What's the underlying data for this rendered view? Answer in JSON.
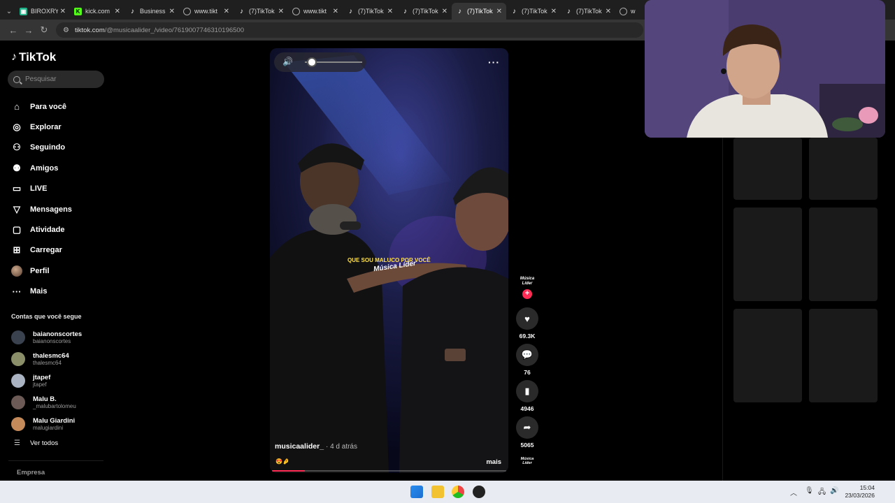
{
  "browser": {
    "tabs": [
      {
        "title": "BIROXRY",
        "icon": "teal-app-icon",
        "active": false
      },
      {
        "title": "kick.com",
        "icon": "kick-icon",
        "active": false
      },
      {
        "title": "Business",
        "icon": "tiktok-icon",
        "active": false
      },
      {
        "title": "www.tikt",
        "icon": "globe-icon",
        "active": false
      },
      {
        "title": "(7)TikTok",
        "icon": "tiktok-icon",
        "active": false
      },
      {
        "title": "www.tikt",
        "icon": "globe-icon",
        "active": false
      },
      {
        "title": "(7)TikTok",
        "icon": "tiktok-icon",
        "active": false
      },
      {
        "title": "(7)TikTok",
        "icon": "tiktok-icon",
        "active": false
      },
      {
        "title": "(7)TikTok",
        "icon": "tiktok-icon",
        "active": true
      },
      {
        "title": "(7)TikTok",
        "icon": "tiktok-icon",
        "active": false
      },
      {
        "title": "(7)TikTok",
        "icon": "tiktok-icon",
        "active": false
      },
      {
        "title": "w",
        "icon": "globe-icon",
        "active": false
      }
    ],
    "url_host": "tiktok.com",
    "url_path": "/@musicaalider_/video/7619007746310196500"
  },
  "sidebar": {
    "logo": "TikTok",
    "search_placeholder": "Pesquisar",
    "nav": [
      {
        "label": "Para você",
        "icon": "home-icon",
        "glyph": "⌂"
      },
      {
        "label": "Explorar",
        "icon": "compass-icon",
        "glyph": "◎"
      },
      {
        "label": "Seguindo",
        "icon": "following-icon",
        "glyph": "⚇"
      },
      {
        "label": "Amigos",
        "icon": "friends-icon",
        "glyph": "⚉"
      },
      {
        "label": "LIVE",
        "icon": "live-icon",
        "glyph": "▭"
      },
      {
        "label": "Mensagens",
        "icon": "messages-icon",
        "glyph": "▽",
        "badge": "7"
      },
      {
        "label": "Atividade",
        "icon": "activity-icon",
        "glyph": "▢"
      },
      {
        "label": "Carregar",
        "icon": "upload-icon",
        "glyph": "⊞"
      },
      {
        "label": "Perfil",
        "icon": "profile-avatar-icon",
        "glyph": ""
      },
      {
        "label": "Mais",
        "icon": "more-icon",
        "glyph": "···"
      }
    ],
    "following_header": "Contas que você segue",
    "following": [
      {
        "name": "baianonscortes",
        "handle": "baianonscortes",
        "color": "#3a4250"
      },
      {
        "name": "thalesmc64",
        "handle": "thalesmc64",
        "color": "#8a8f6a"
      },
      {
        "name": "jtapef",
        "handle": "jtapef",
        "color": "#a9b3c2"
      },
      {
        "name": "Malu B.",
        "handle": "_malubartolomeu",
        "color": "#6b5a55"
      },
      {
        "name": "Malu Giardini",
        "handle": "malugiardini",
        "color": "#c48a5a"
      }
    ],
    "see_all": "Ver todos",
    "footer": "Empresa"
  },
  "video": {
    "caption_overlay": "QUE SOU MALUCO POR VOCÊ",
    "watermark": "Música Líder",
    "author": "musicaalider_",
    "time_ago": "· 4 d atrás",
    "emojis": "😍🤌",
    "more_label": "mais",
    "progress": 0.14
  },
  "actions": {
    "avatar_text": "Música Líder",
    "likes": "69.3K",
    "comments": "76",
    "saves": "4946",
    "shares": "5065"
  },
  "taskbar": {
    "time": "15:04",
    "date": "23/03/2026"
  }
}
